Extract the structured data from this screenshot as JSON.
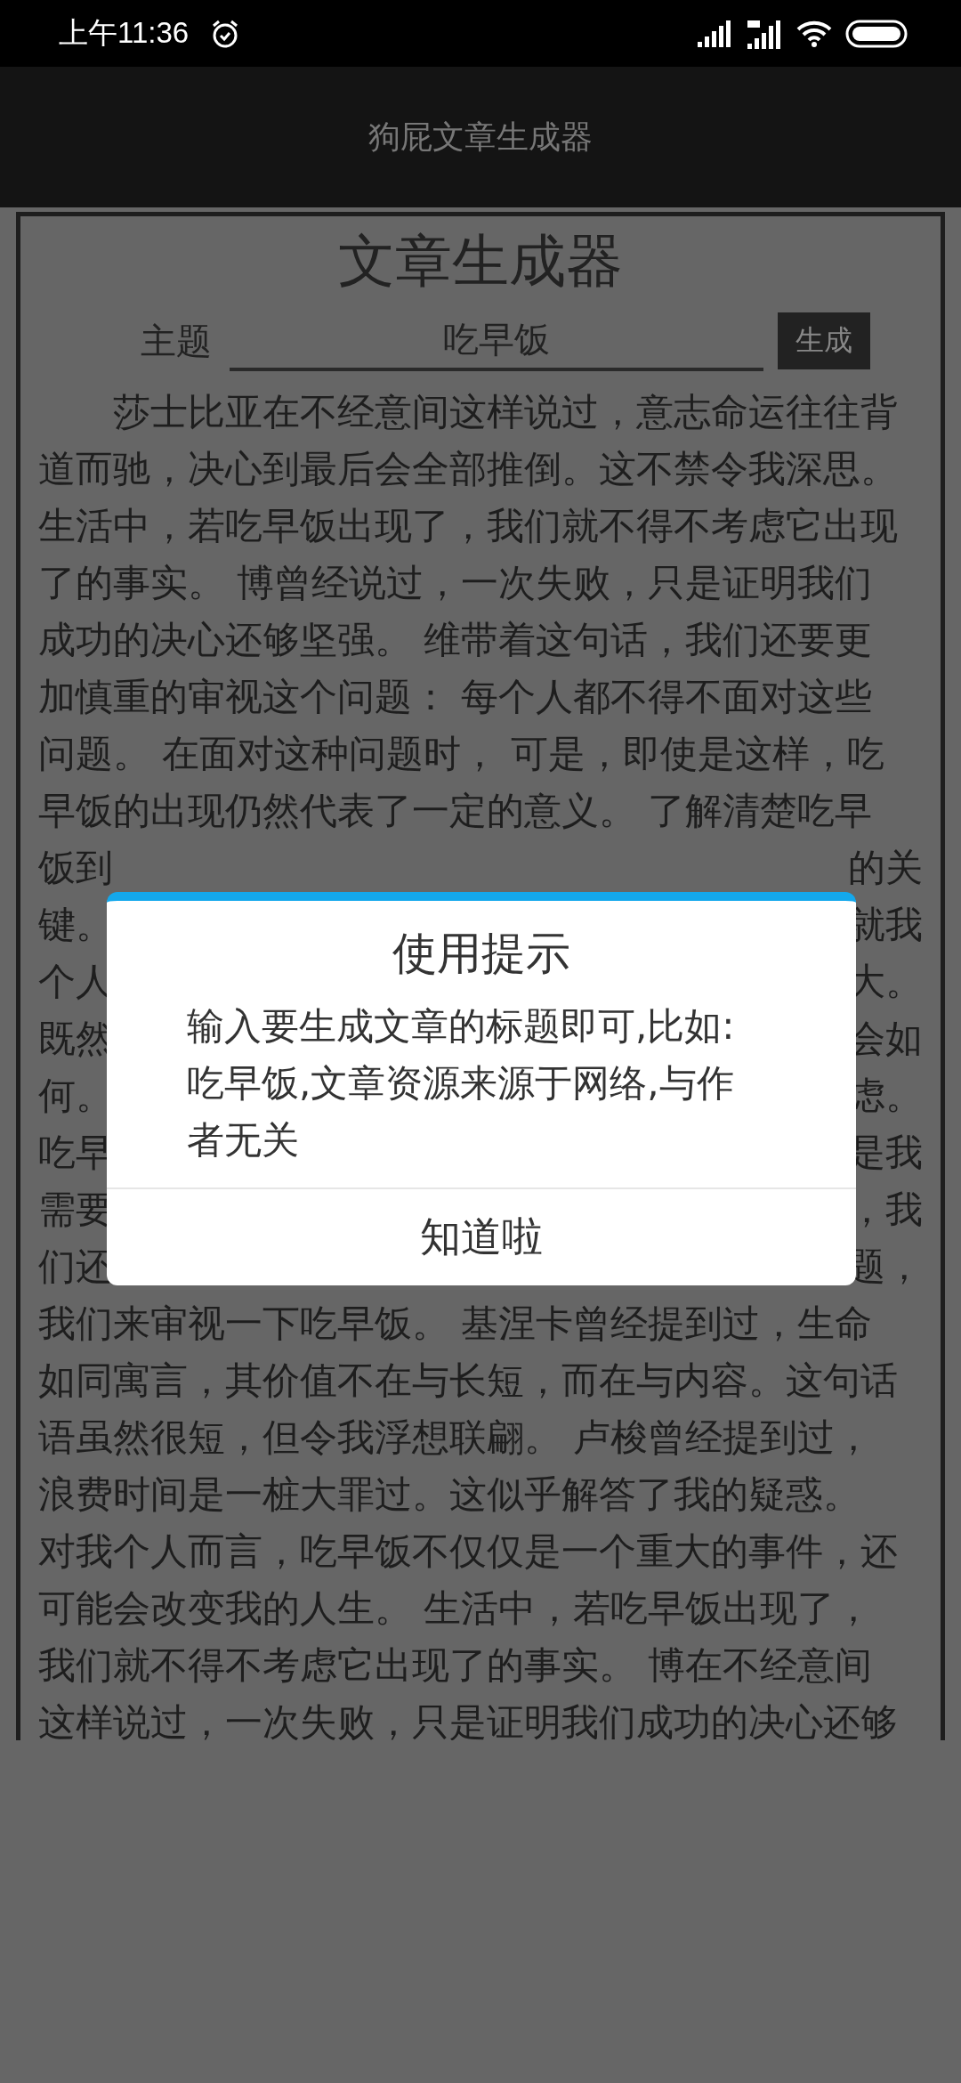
{
  "status_bar": {
    "time": "上午11:36"
  },
  "app_bar": {
    "title": "狗屁文章生成器"
  },
  "heading": "文章生成器",
  "topic": {
    "label": "主题",
    "value": "吃早饭"
  },
  "generate_button": "生成",
  "article": {
    "lines": [
      {
        "kind": "full",
        "text": "莎士比亚在不经意间这样说过，意志命运往往背"
      },
      {
        "kind": "full",
        "text": "道而驰，决心到最后会全部推倒。这不禁令我深思。"
      },
      {
        "kind": "full",
        "text": "生活中，若吃早饭出现了，我们就不得不考虑它出现"
      },
      {
        "kind": "full",
        "text": "了的事实。 博曾经说过，一次失败，只是证明我们"
      },
      {
        "kind": "full",
        "text": "成功的决心还够坚强。 维带着这句话，我们还要更"
      },
      {
        "kind": "full",
        "text": "加慎重的审视这个问题： 每个人都不得不面对这些"
      },
      {
        "kind": "full",
        "text": "问题。 在面对这种问题时， 可是，即使是这样，吃"
      },
      {
        "kind": "full",
        "text": "早饭的出现仍然代表了一定的意义。 了解清楚吃早"
      },
      {
        "kind": "split",
        "left": "饭到",
        "right": "的关"
      },
      {
        "kind": "split",
        "left": "键。",
        "right": "就我"
      },
      {
        "kind": "split",
        "left": "个人",
        "right": "大。"
      },
      {
        "kind": "split",
        "left": "既然",
        "right": "会如"
      },
      {
        "kind": "split",
        "left": "何。",
        "right": "虑。"
      },
      {
        "kind": "split",
        "left": "吃早",
        "right": "是我"
      },
      {
        "kind": "split",
        "left": "需要",
        "right": "，我"
      },
      {
        "kind": "split",
        "left": "们还",
        "right": "题，"
      },
      {
        "kind": "full",
        "text": "我们来审视一下吃早饭。 基涅卡曾经提到过，生命"
      },
      {
        "kind": "full",
        "text": "如同寓言，其价值不在与长短，而在与内容。这句话"
      },
      {
        "kind": "full",
        "text": "语虽然很短，但令我浮想联翩。 卢梭曾经提到过，"
      },
      {
        "kind": "full",
        "text": "浪费时间是一桩大罪过。这似乎解答了我的疑惑。"
      },
      {
        "kind": "full",
        "text": "对我个人而言，吃早饭不仅仅是一个重大的事件，还"
      },
      {
        "kind": "full",
        "text": "可能会改变我的人生。 生活中，若吃早饭出现了，"
      },
      {
        "kind": "full",
        "text": "我们就不得不考虑它出现了的事实。 博在不经意间"
      },
      {
        "kind": "full",
        "text": "这样说过，一次失败，只是证明我们成功的决心还够"
      }
    ]
  },
  "dialog": {
    "title": "使用提示",
    "message": "输入要生成文章的标题即可,比如:吃早饭,文章资源来源于网络,与作者无关",
    "button": "知道啦"
  }
}
